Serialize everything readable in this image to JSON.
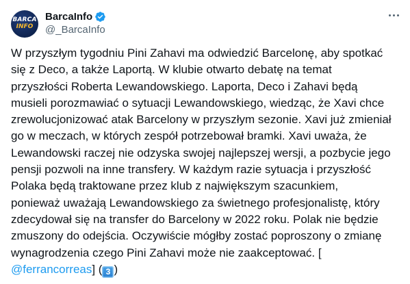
{
  "author": {
    "display_name": "BarcaInfo",
    "handle": "@_BarcaInfo",
    "avatar_text_line1": "BARCA",
    "avatar_text_line2": "INFO",
    "verified": true
  },
  "tweet": {
    "lines": [
      "W przyszłym tygodniu Pini Zahavi ma odwiedzić Barcelonę, aby spotkać",
      "się z Deco, a także Laportą. W klubie otwarto debatę  na temat",
      "przyszłości Roberta Lewandowskiego. Laporta, Deco i Zahavi będą",
      "musieli porozmawiać o sytuacji Lewandowskiego, wiedząc, że Xavi chce",
      "zrewolucjonizować atak Barcelony w przyszłym sezonie. Xavi już zmieniał",
      "go w meczach, w których zespół potrzebował bramki. Xavi uważa, że",
      "Lewandowski raczej nie odzyska swojej najlepszej wersji, a pozbycie jego",
      "pensji pozwoli na inne transfery. W każdym razie sytuacja i przyszłość",
      "Polaka będą traktowane przez klub z największym szacunkiem,",
      "ponieważ uważają Lewandowskiego za świetnego profesjonalistę, który",
      "zdecydował się na transfer do Barcelony w 2022 roku. Polak nie będzie",
      "zmuszony do odejścia. Oczywiście mógłby zostać poproszony o zmianę",
      "wynagrodzenia czego Pini Zahavi może nie zaakceptować. ["
    ],
    "mention": "@ferrancorreas",
    "after_mention": "] (",
    "keycap": "3",
    "closing": ")"
  },
  "colors": {
    "text": "#0f1419",
    "secondary": "#536471",
    "link": "#1d9bf0",
    "verified_badge": "#1d9bf0"
  },
  "icons": {
    "verified": "verified-badge-icon",
    "more": "more-options-icon",
    "keycap": "keycap-digit-three-icon"
  }
}
